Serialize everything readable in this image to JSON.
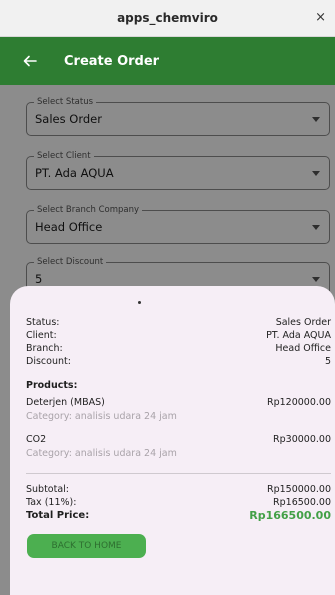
{
  "window": {
    "title": "apps_chemviro",
    "close_glyph": "×"
  },
  "app_bar": {
    "title": "Create Order",
    "back_icon": "arrow-left-icon",
    "color": "#2e7d32"
  },
  "form": {
    "fields": [
      {
        "label": "Select Status",
        "value": "Sales Order"
      },
      {
        "label": "Select Client",
        "value": "PT. Ada AQUA"
      },
      {
        "label": "Select Branch Company",
        "value": "Head Office"
      },
      {
        "label": "Select Discount",
        "value": "5"
      }
    ]
  },
  "summary": {
    "status_label": "Status:",
    "status_value": "Sales Order",
    "client_label": "Client:",
    "client_value": "PT. Ada AQUA",
    "branch_label": "Branch:",
    "branch_value": "Head Office",
    "discount_label": "Discount:",
    "discount_value": "5",
    "products_title": "Products:",
    "products": [
      {
        "name": "Deterjen (MBAS)",
        "price": "Rp120000.00",
        "category": "Category: analisis udara 24 jam"
      },
      {
        "name": "CO2",
        "price": "Rp30000.00",
        "category": "Category: analisis udara 24 jam"
      }
    ],
    "subtotal_label": "Subtotal:",
    "subtotal_value": "Rp150000.00",
    "tax_label": "Tax (11%):",
    "tax_value": "Rp16500.00",
    "total_label": "Total Price:",
    "total_value": "Rp166500.00",
    "total_color": "#43a047",
    "button_label": "BACK TO HOME",
    "button_color": "#4caf50"
  }
}
